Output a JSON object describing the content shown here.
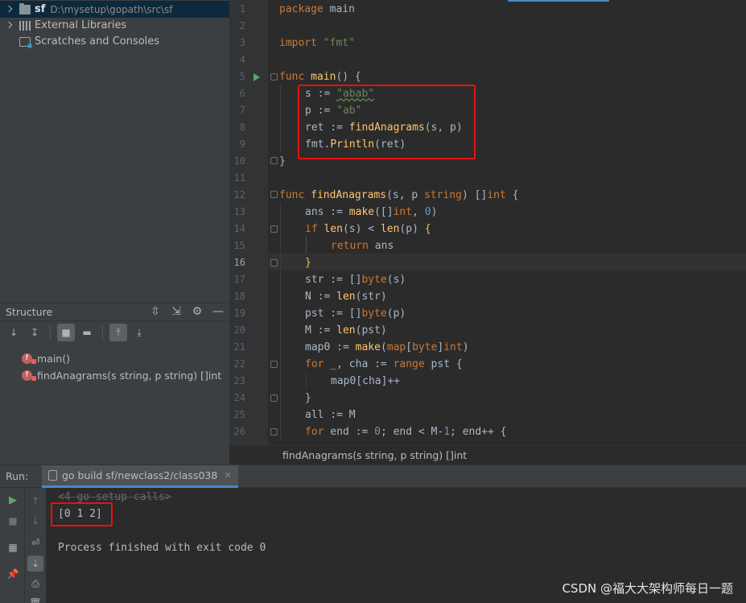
{
  "project_tree": {
    "root_name": "sf",
    "root_path": "D:\\mysetup\\gopath\\src\\sf",
    "external_libraries": "External Libraries",
    "scratches": "Scratches and Consoles"
  },
  "structure": {
    "title": "Structure",
    "items": [
      {
        "badge": "f",
        "label": "main()"
      },
      {
        "badge": "f",
        "label": "findAnagrams(s string, p string) []int"
      }
    ]
  },
  "editor": {
    "line_numbers": [
      "1",
      "2",
      "3",
      "4",
      "5",
      "6",
      "7",
      "8",
      "9",
      "10",
      "11",
      "12",
      "13",
      "14",
      "15",
      "16",
      "17",
      "18",
      "19",
      "20",
      "21",
      "22",
      "23",
      "24",
      "25",
      "26"
    ],
    "current_line": "16",
    "breadcrumb": "findAnagrams(s string, p string) []int",
    "code": {
      "l1_kw": "package",
      "l1_rest": " main",
      "l3_kw": "import",
      "l3_str": "\"fmt\"",
      "l5_kw": "func",
      "l5_fn": "main",
      "l5_rest": "() {",
      "l6_a": "s := ",
      "l6_s": "\"abab\"",
      "l7_a": "p := ",
      "l7_s": "\"ab\"",
      "l8_a": "ret := ",
      "l8_fn": "findAnagrams",
      "l8_rest": "(s, p)",
      "l9_pkg": "fmt.",
      "l9_fn": "Println",
      "l9_rest": "(ret)",
      "l10": "}",
      "l12_kw": "func",
      "l12_fn": "findAnagrams",
      "l12_a": "(s, p ",
      "l12_t1": "string",
      "l12_b": ") []",
      "l12_t2": "int",
      "l12_c": " {",
      "l13_a": "ans := ",
      "l13_fn": "make",
      "l13_b": "([]",
      "l13_t": "int",
      "l13_c": ", ",
      "l13_n": "0",
      "l13_d": ")",
      "l14_kw": "if",
      "l14_fn1": "len",
      "l14_a": "(s) < ",
      "l14_fn2": "len",
      "l14_b": "(p) ",
      "l14_br": "{",
      "l15_kw": "return",
      "l15_rest": " ans",
      "l16": "}",
      "l17_a": "str := []",
      "l17_t": "byte",
      "l17_b": "(s)",
      "l18_a": "N := ",
      "l18_fn": "len",
      "l18_b": "(str)",
      "l19_a": "pst := []",
      "l19_t": "byte",
      "l19_b": "(p)",
      "l20_a": "M := ",
      "l20_fn": "len",
      "l20_b": "(pst)",
      "l21_a": "map0 := ",
      "l21_fn": "make",
      "l21_b": "(",
      "l21_kw": "map",
      "l21_c": "[",
      "l21_t1": "byte",
      "l21_d": "]",
      "l21_t2": "int",
      "l21_e": ")",
      "l22_kw": "for",
      "l22_a": " _, cha := ",
      "l22_kw2": "range",
      "l22_b": " pst {",
      "l23": "map0[cha]++",
      "l24": "}",
      "l25": "all := M",
      "l26_kw": "for",
      "l26_a": " end := ",
      "l26_n": "0",
      "l26_b": "; end < M-",
      "l26_n2": "1",
      "l26_c": "; end++ {"
    }
  },
  "run": {
    "label": "Run:",
    "tab": "go build sf/newclass2/class038",
    "console": [
      "<4 go setup calls>",
      "[0 1 2]",
      "",
      "Process finished with exit code 0"
    ]
  },
  "watermark": "CSDN @福大大架构师每日一题",
  "colors": {
    "highlight_box": "#e8110f",
    "keyword": "#cc7832",
    "string": "#6a8759",
    "number": "#6897bb",
    "function": "#ffc66d"
  }
}
